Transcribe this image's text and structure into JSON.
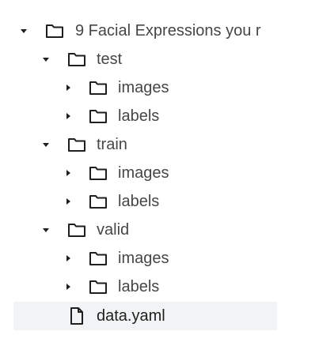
{
  "tree": {
    "root": {
      "label": "9 Facial Expressions you r"
    },
    "test": {
      "label": "test",
      "images": "images",
      "labels": "labels"
    },
    "train": {
      "label": "train",
      "images": "images",
      "labels": "labels"
    },
    "valid": {
      "label": "valid",
      "images": "images",
      "labels": "labels"
    },
    "file": {
      "label": "data.yaml"
    }
  },
  "colors": {
    "text": "#444746",
    "icon": "#1f1f1f",
    "selected_bg": "#f1f3f4"
  }
}
